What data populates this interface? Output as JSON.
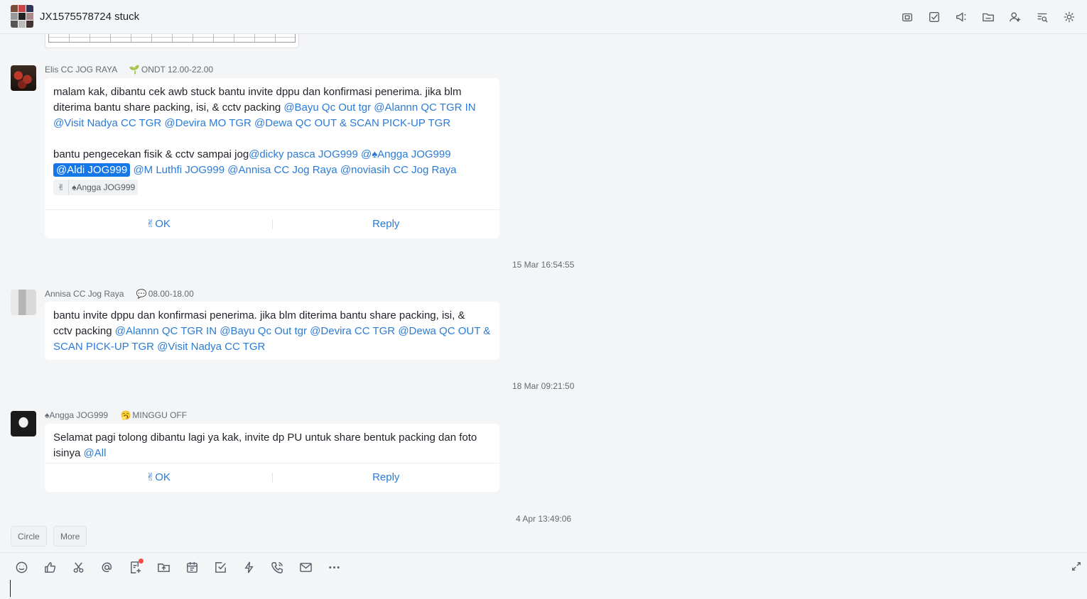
{
  "header": {
    "title": "JX1575578724 stuck",
    "icons": [
      "video-call-icon",
      "task-icon",
      "announcement-icon",
      "folder-icon",
      "add-member-icon",
      "search-history-icon",
      "settings-icon"
    ]
  },
  "messages": [
    {
      "sender": "Elis CC JOG RAYA",
      "status_icon": "🌱",
      "status": "ONDT 12.00-22.00",
      "line1_text": "malam kak, dibantu cek awb stuck bantu invite dppu dan konfirmasi penerima. jika blm",
      "line2_text": "diterima bantu share packing, isi, & cctv packing ",
      "mentions_a": [
        "@Bayu Qc Out tgr",
        "@Alannn QC TGR IN",
        "@Visit Nadya CC TGR",
        "@Devira MO TGR",
        "@Dewa QC OUT & SCAN PICK-UP TGR"
      ],
      "line4_text": "bantu pengecekan fisik & cctv sampai jog",
      "mentions_b": [
        "@dicky pasca JOG999",
        "@♠Angga JOG999",
        "@Aldi JOG999",
        "@M Luthfi JOG999",
        "@Annisa CC Jog Raya",
        "@noviasih CC Jog Raya"
      ],
      "reaction_emoji": "✌",
      "reaction_user": "♠Angga JOG999",
      "action_ok": "✌OK",
      "action_reply": "Reply"
    },
    {
      "timestamp": "15 Mar 16:54:55",
      "sender": "Annisa CC Jog Raya",
      "status_icon": "💬",
      "status": "08.00-18.00",
      "line1_text": "bantu invite dppu dan konfirmasi penerima. jika blm diterima bantu share packing, isi, &",
      "line2_text": "cctv packing ",
      "mentions": [
        "@Alannn QC TGR IN",
        "@Bayu Qc Out tgr",
        "@Devira CC TGR",
        "@Dewa QC OUT &",
        "SCAN PICK-UP TGR",
        "@Visit Nadya CC TGR"
      ]
    },
    {
      "timestamp": "18 Mar 09:21:50",
      "sender": "♠Angga JOG999",
      "status_icon": "🥱",
      "status": "MINGGU OFF",
      "line1_text": "Selamat pagi tolong dibantu lagi ya kak, invite dp PU untuk share bentuk packing dan foto",
      "line2_text": "isinya ",
      "mention": "@All",
      "action_ok": "✌OK",
      "action_reply": "Reply"
    }
  ],
  "last_timestamp": "4 Apr 13:49:06",
  "quick_buttons": [
    "Circle",
    "More"
  ],
  "composer": {
    "toolbar": [
      "emoji-icon",
      "like-icon",
      "scissors-icon",
      "mention-icon",
      "doc-icon",
      "upload-icon",
      "calendar-icon",
      "task-check-icon",
      "lightning-icon",
      "phone-icon",
      "mail-icon",
      "more-icon"
    ],
    "input_value": ""
  },
  "colors": {
    "accent": "#2b7bd6",
    "highlight": "#1677e6",
    "background": "#f4f5f7",
    "bubble": "#ffffff",
    "notification_dot": "#f54a45"
  }
}
